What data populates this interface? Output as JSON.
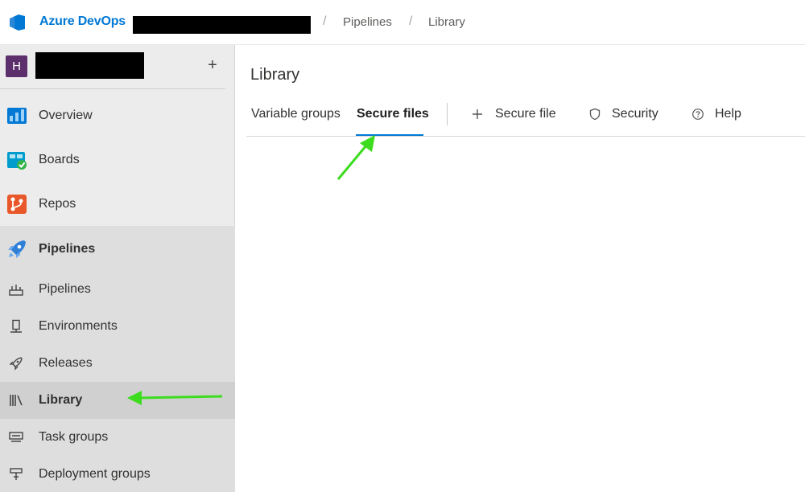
{
  "header": {
    "brand": "Azure DevOps",
    "breadcrumbs": [
      "Pipelines",
      "Library"
    ],
    "separator": "/"
  },
  "sidebar": {
    "project_initial": "H",
    "add_symbol": "+",
    "items": [
      {
        "label": "Overview",
        "icon": "overview-icon"
      },
      {
        "label": "Boards",
        "icon": "boards-icon"
      },
      {
        "label": "Repos",
        "icon": "repos-icon"
      },
      {
        "label": "Pipelines",
        "icon": "pipelines-rocket-icon"
      },
      {
        "label": "Pipelines",
        "icon": "pipelines-sub-icon"
      },
      {
        "label": "Environments",
        "icon": "environments-icon"
      },
      {
        "label": "Releases",
        "icon": "releases-icon"
      },
      {
        "label": "Library",
        "icon": "library-icon",
        "selected": true
      },
      {
        "label": "Task groups",
        "icon": "task-groups-icon"
      },
      {
        "label": "Deployment groups",
        "icon": "deployment-groups-icon"
      }
    ]
  },
  "main": {
    "title": "Library",
    "tabs": [
      {
        "label": "Variable groups"
      },
      {
        "label": "Secure files",
        "active": true
      }
    ],
    "commands": [
      {
        "label": "Secure file",
        "icon": "plus-icon"
      },
      {
        "label": "Security",
        "icon": "shield-icon"
      },
      {
        "label": "Help",
        "icon": "help-circle-icon"
      }
    ]
  },
  "colors": {
    "accent": "#0078d4",
    "annotation_arrow": "#3ddc1f",
    "project_avatar": "#5c2e6b"
  }
}
